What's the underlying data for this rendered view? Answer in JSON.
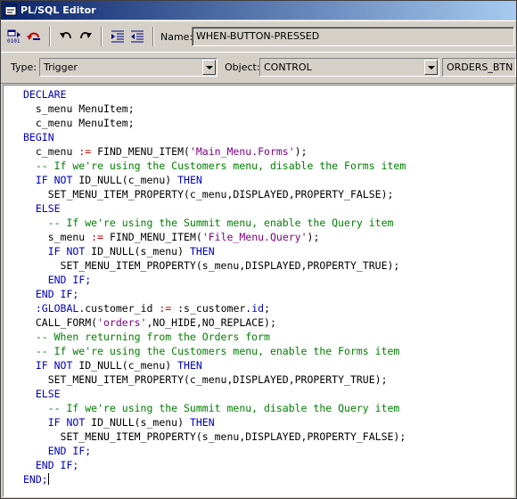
{
  "window": {
    "title": "PL/SQL Editor"
  },
  "toolbar": {
    "name_label": "Name:",
    "name_value": "WHEN-BUTTON-PRESSED"
  },
  "context": {
    "type_label": "Type:",
    "type_value": "Trigger",
    "object_label": "Object:",
    "object_value": "CONTROL",
    "item_value": "ORDERS_BTN"
  },
  "code_lines": [
    [
      {
        "t": "DECLARE",
        "c": "kw"
      }
    ],
    [
      {
        "t": "  s_menu MenuItem;",
        "c": ""
      }
    ],
    [
      {
        "t": "  c_menu MenuItem;",
        "c": ""
      }
    ],
    [
      {
        "t": "BEGIN",
        "c": "kw"
      }
    ],
    [
      {
        "t": "  c_menu ",
        "c": ""
      },
      {
        "t": ":=",
        "c": "op"
      },
      {
        "t": " FIND_MENU_ITEM(",
        "c": ""
      },
      {
        "t": "'Main_Menu.Forms'",
        "c": "str"
      },
      {
        "t": ");",
        "c": ""
      }
    ],
    [
      {
        "t": "  -- If we're using the Customers menu, disable the Forms item",
        "c": "cm"
      }
    ],
    [
      {
        "t": "  ",
        "c": ""
      },
      {
        "t": "IF NOT",
        "c": "kw"
      },
      {
        "t": " ID_NULL(c_menu) ",
        "c": ""
      },
      {
        "t": "THEN",
        "c": "kw"
      }
    ],
    [
      {
        "t": "    SET_MENU_ITEM_PROPERTY(c_menu,DISPLAYED,PROPERTY_FALSE);",
        "c": ""
      }
    ],
    [
      {
        "t": "  ",
        "c": ""
      },
      {
        "t": "ELSE",
        "c": "kw"
      }
    ],
    [
      {
        "t": "    -- If we're using the Summit menu, enable the Query item",
        "c": "cm"
      }
    ],
    [
      {
        "t": "    s_menu ",
        "c": ""
      },
      {
        "t": ":=",
        "c": "op"
      },
      {
        "t": " FIND_MENU_ITEM(",
        "c": ""
      },
      {
        "t": "'File_Menu.Query'",
        "c": "str"
      },
      {
        "t": ");",
        "c": ""
      }
    ],
    [
      {
        "t": "    ",
        "c": ""
      },
      {
        "t": "IF NOT",
        "c": "kw"
      },
      {
        "t": " ID_NULL(s_menu) ",
        "c": ""
      },
      {
        "t": "THEN",
        "c": "kw"
      }
    ],
    [
      {
        "t": "      SET_MENU_ITEM_PROPERTY(s_menu,DISPLAYED,PROPERTY_TRUE);",
        "c": ""
      }
    ],
    [
      {
        "t": "    ",
        "c": ""
      },
      {
        "t": "END IF;",
        "c": "kw"
      }
    ],
    [
      {
        "t": "  ",
        "c": ""
      },
      {
        "t": "END IF;",
        "c": "kw"
      }
    ],
    [
      {
        "t": "  ",
        "c": ""
      },
      {
        "t": ":GLOBAL",
        "c": "kw"
      },
      {
        "t": ".customer_id ",
        "c": ""
      },
      {
        "t": ":=",
        "c": "op"
      },
      {
        "t": " :s_customer.",
        "c": ""
      },
      {
        "t": "id",
        "c": "kw"
      },
      {
        "t": ";",
        "c": ""
      }
    ],
    [
      {
        "t": "  CALL_FORM(",
        "c": ""
      },
      {
        "t": "'orders'",
        "c": "str"
      },
      {
        "t": ",NO_HIDE,NO_REPLACE);",
        "c": ""
      }
    ],
    [
      {
        "t": "  -- When returning from the Orders form",
        "c": "cm"
      }
    ],
    [
      {
        "t": "  -- If we're using the Customers menu, enable the Forms item",
        "c": "cm"
      }
    ],
    [
      {
        "t": "  ",
        "c": ""
      },
      {
        "t": "IF NOT",
        "c": "kw"
      },
      {
        "t": " ID_NULL(c_menu) ",
        "c": ""
      },
      {
        "t": "THEN",
        "c": "kw"
      }
    ],
    [
      {
        "t": "    SET_MENU_ITEM_PROPERTY(c_menu,DISPLAYED,PROPERTY_TRUE);",
        "c": ""
      }
    ],
    [
      {
        "t": "  ",
        "c": ""
      },
      {
        "t": "ELSE",
        "c": "kw"
      }
    ],
    [
      {
        "t": "    -- If we're using the Summit menu, disable the Query item",
        "c": "cm"
      }
    ],
    [
      {
        "t": "    ",
        "c": ""
      },
      {
        "t": "IF NOT",
        "c": "kw"
      },
      {
        "t": " ID_NULL(s_menu) ",
        "c": ""
      },
      {
        "t": "THEN",
        "c": "kw"
      }
    ],
    [
      {
        "t": "      SET_MENU_ITEM_PROPERTY(s_menu,DISPLAYED,PROPERTY_FALSE);",
        "c": ""
      }
    ],
    [
      {
        "t": "    ",
        "c": ""
      },
      {
        "t": "END IF;",
        "c": "kw"
      }
    ],
    [
      {
        "t": "  ",
        "c": ""
      },
      {
        "t": "END IF;",
        "c": "kw"
      }
    ],
    [
      {
        "t": "END;",
        "c": "kw"
      }
    ]
  ],
  "colors": {
    "keyword": "#0000c0",
    "string": "#800080",
    "comment": "#008000",
    "operator": "#c00000",
    "titlebar": "#0a246a"
  },
  "icons": [
    "compile-icon",
    "revert-icon",
    "undo-icon",
    "redo-icon",
    "indent-icon",
    "outdent-icon",
    "editor-app-icon"
  ]
}
